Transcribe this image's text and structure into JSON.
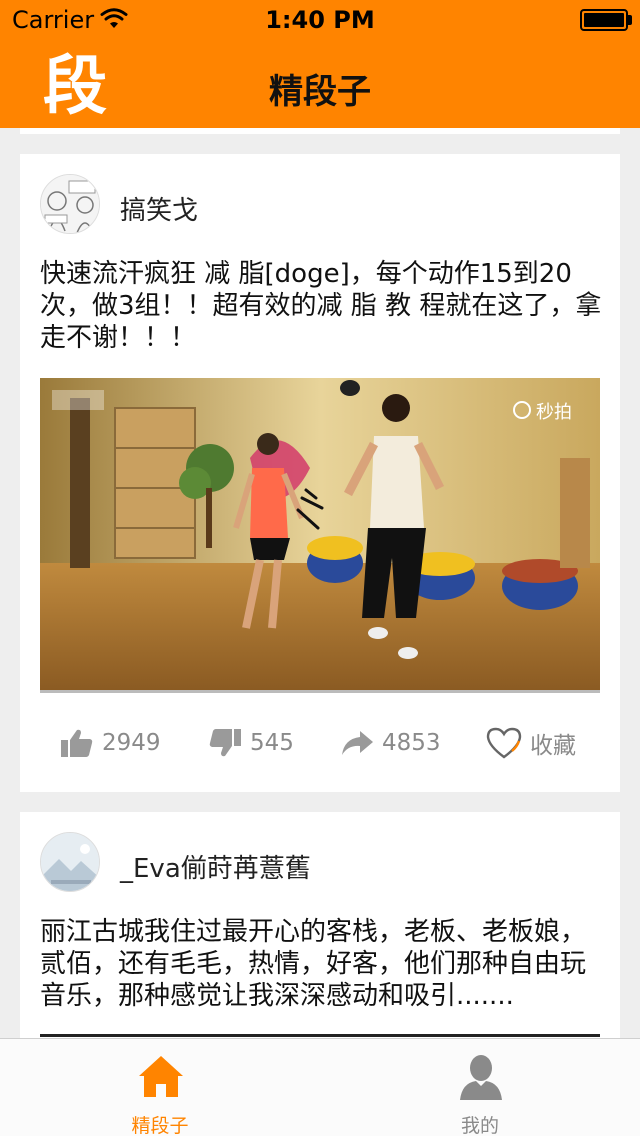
{
  "status_bar": {
    "carrier": "Carrier",
    "time": "1:40 PM"
  },
  "nav": {
    "logo_text": "段",
    "title": "精段子"
  },
  "posts": [
    {
      "username": "搞笑戈",
      "text": "快速流汗疯狂 减 脂[doge]，每个动作15到20次，做3组！！超有效的减 脂 教 程就在这了，拿走不谢！！！",
      "video_watermark": "秒拍",
      "likes": "2949",
      "dislikes": "545",
      "shares": "4853",
      "favorite_label": "收藏"
    },
    {
      "username": "_Eva偂莳苒薏舊",
      "text": "丽江古城我住过最开心的客栈，老板、老板娘，贰佰，还有毛毛，热情，好客，他们那种自由玩音乐，那种感觉让我深深感动和吸引......."
    }
  ],
  "tabs": [
    {
      "label": "精段子",
      "icon": "home-icon",
      "active": true
    },
    {
      "label": "我的",
      "icon": "person-icon",
      "active": false
    }
  ],
  "colors": {
    "brand": "#ff8400",
    "background": "#eeeeee",
    "inactive": "#8a8a8a"
  }
}
